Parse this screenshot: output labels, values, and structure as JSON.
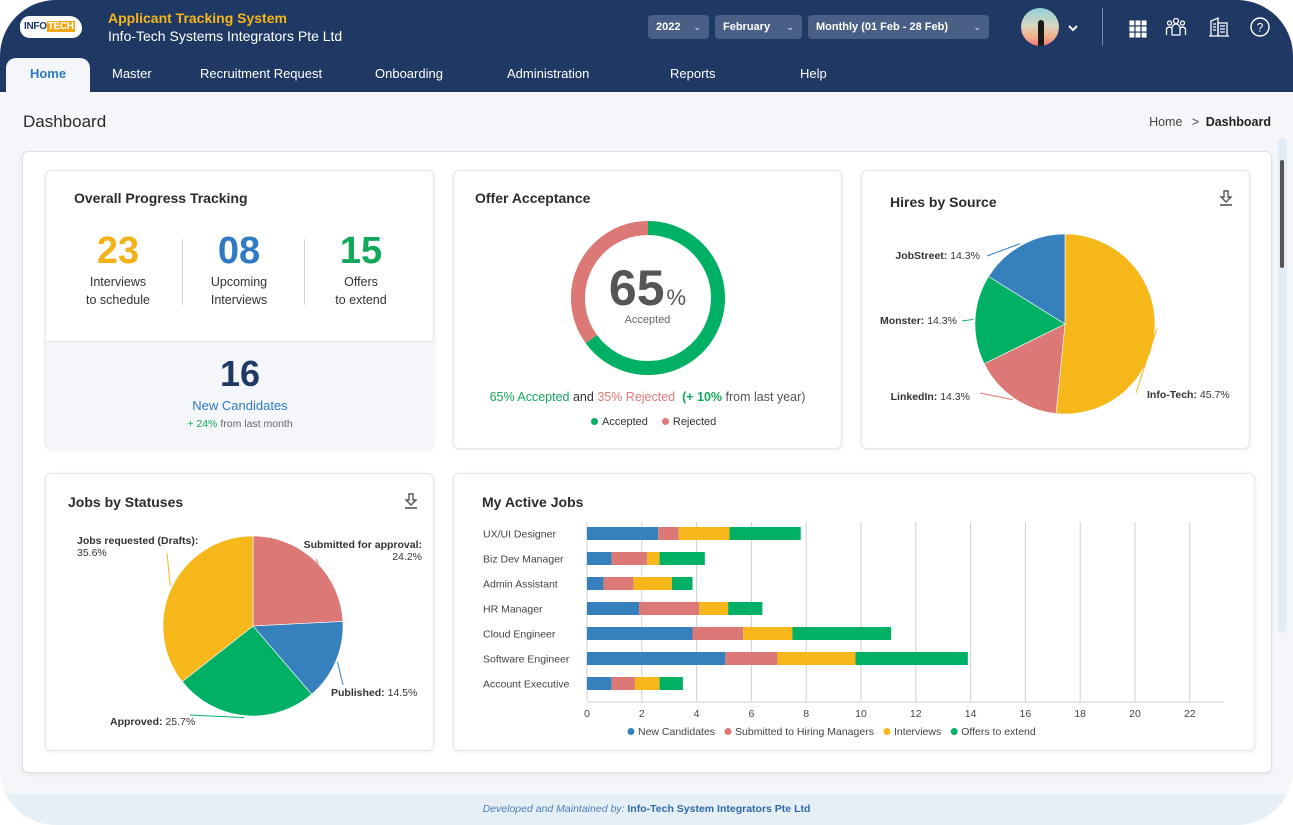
{
  "header": {
    "logo_left": "INFO",
    "logo_right": "TECH",
    "app_title": "Applicant Tracking System",
    "company": "Info-Tech Systems Integrators Pte Ltd",
    "year_select": "2022",
    "month_select": "February",
    "range_select": "Monthly (01 Feb - 28 Feb)",
    "icons": [
      "apps-grid-icon",
      "team-icon",
      "building-icon",
      "help-icon"
    ]
  },
  "nav": {
    "tabs": [
      {
        "label": "Home",
        "active": true
      },
      {
        "label": "Master"
      },
      {
        "label": "Recruitment Request"
      },
      {
        "label": "Onboarding"
      },
      {
        "label": "Administration"
      },
      {
        "label": "Reports"
      },
      {
        "label": "Help"
      }
    ]
  },
  "page": {
    "title": "Dashboard",
    "breadcrumb_home": "Home",
    "breadcrumb_sep": ">",
    "breadcrumb_current": "Dashboard"
  },
  "progress": {
    "title": "Overall Progress Tracking",
    "stats": [
      {
        "value": "23",
        "line1": "Interviews",
        "line2": "to schedule",
        "color": "#f3b21a"
      },
      {
        "value": "08",
        "line1": "Upcoming",
        "line2": "Interviews",
        "color": "#2e7bc4"
      },
      {
        "value": "15",
        "line1": "Offers",
        "line2": "to extend",
        "color": "#12a85b"
      }
    ],
    "new_candidates": {
      "value": "16",
      "label": "New Candidates",
      "change": "+ 24%",
      "change_suffix": "from last month"
    }
  },
  "offer": {
    "title": "Offer Acceptance",
    "percent": "65",
    "percent_sign": "%",
    "center_label": "Accepted",
    "summary_accepted": "65% Accepted",
    "summary_and": "and",
    "summary_rejected": "35% Rejected",
    "summary_change": "(+ 10%",
    "summary_suffix": "from last year)",
    "legend": [
      {
        "label": "Accepted",
        "color": "#00b065"
      },
      {
        "label": "Rejected",
        "color": "#dc7876"
      }
    ]
  },
  "footer": {
    "prefix": "Developed and Maintained by:",
    "company": "Info-Tech System Integrators Pte Ltd"
  },
  "chart_data": [
    {
      "type": "pie",
      "title": "Offer Acceptance",
      "categories": [
        "Accepted",
        "Rejected"
      ],
      "values": [
        65,
        35
      ],
      "colors": [
        "#00b065",
        "#dc7876"
      ],
      "legend": "bottom"
    },
    {
      "type": "pie",
      "title": "Hires by Source",
      "categories": [
        "Info-Tech",
        "LinkedIn",
        "Monster",
        "JobStreet"
      ],
      "values": [
        45.7,
        14.3,
        14.3,
        14.3
      ],
      "labels": [
        "Info-Tech: 45.7%",
        "LinkedIn: 14.3%",
        "Monster: 14.3%",
        "JobStreet: 14.3%"
      ],
      "colors": [
        "#f5b71a",
        "#dc7876",
        "#00b065",
        "#3580bd"
      ]
    },
    {
      "type": "pie",
      "title": "Jobs by Statuses",
      "categories": [
        "Submitted for approval",
        "Published",
        "Approved",
        "Jobs requested (Drafts)"
      ],
      "values": [
        24.2,
        14.5,
        25.7,
        35.6
      ],
      "labels": [
        "Submitted for approval:",
        "Published:",
        "Approved:",
        "Jobs requested (Drafts):"
      ],
      "value_labels": [
        "24.2%",
        "14.5%",
        "25.7%",
        "35.6%"
      ],
      "colors": [
        "#dc7876",
        "#3580bd",
        "#00b065",
        "#f5b71a"
      ]
    },
    {
      "type": "bar",
      "orientation": "horizontal",
      "stacked": true,
      "title": "My Active Jobs",
      "categories": [
        "UX/UI Designer",
        "Biz Dev Manager",
        "Admin Assistant",
        "HR Manager",
        "Cloud Engineer",
        "Software Engineer",
        "Account Executive"
      ],
      "series": [
        {
          "name": "New Candidates",
          "color": "#3580bd",
          "values": [
            2.6,
            0.9,
            0.6,
            1.9,
            3.85,
            5.05,
            0.9
          ]
        },
        {
          "name": "Submitted to Hiring Managers",
          "color": "#dc7876",
          "values": [
            0.75,
            1.3,
            1.1,
            2.2,
            1.85,
            1.9,
            0.85
          ]
        },
        {
          "name": "Interviews",
          "color": "#f5b71a",
          "values": [
            1.85,
            0.45,
            1.4,
            1.05,
            1.8,
            2.85,
            0.9
          ]
        },
        {
          "name": "Offers to extend",
          "color": "#00b065",
          "values": [
            2.6,
            1.65,
            0.75,
            1.25,
            3.6,
            4.1,
            0.85
          ]
        }
      ],
      "xlim": [
        0,
        23
      ],
      "xticks": [
        0,
        2,
        4,
        6,
        8,
        10,
        12,
        14,
        16,
        18,
        20,
        22
      ],
      "grid": true,
      "legend": "bottom"
    }
  ]
}
